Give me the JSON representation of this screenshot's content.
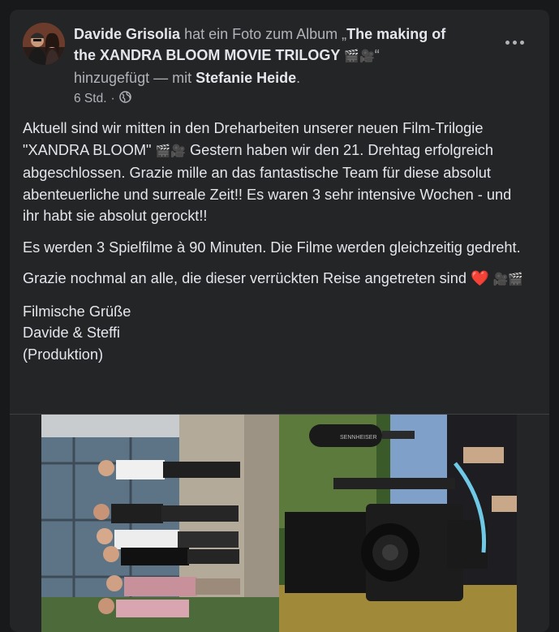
{
  "post": {
    "author": "Davide Grisolia",
    "action_prefix": "hat ein Foto zum Album „",
    "album": "The making of the XANDRA BLOOM MOVIE TRILOGY",
    "album_emoji": "🎬🎥",
    "action_suffix": "“ hinzugefügt",
    "with_label": "— mit",
    "tagged": "Stefanie Heide",
    "period": ".",
    "time": "6 Std.",
    "separator": "·",
    "privacy_icon": "globe-icon",
    "more_icon": "more-options-icon"
  },
  "content": {
    "p1_a": "Aktuell sind wir mitten in den Dreharbeiten unserer neuen Film-Trilogie \"XANDRA BLOOM\"",
    "p1_emoji": "🎬🎥",
    "p1_b": "Gestern haben wir den 21. Drehtag erfolgreich abgeschlossen. Grazie mille an das fantastische Team für diese absolut abenteuerliche und surreale Zeit!! Es waren 3 sehr intensive Wochen - und ihr habt sie absolut gerockt!!",
    "p2": "Es werden 3 Spielfilme à 90 Minuten. Die Filme werden gleichzeitig gedreht.",
    "p3": "Grazie nochmal an alle, die dieser verrückten Reise angetreten sind",
    "p3_heart": "❤️",
    "p3_emoji": "🎥🎬",
    "sig_1": "Filmische Grüße",
    "sig_2": "Davide & Steffi",
    "sig_3": "(Produktion)"
  },
  "colors": {
    "card_bg": "#242526",
    "text_primary": "#e4e6eb",
    "text_secondary": "#b0b3b8",
    "heart": "#e41e3f"
  },
  "photo": {
    "mic_brand": "SENNHEISER"
  }
}
